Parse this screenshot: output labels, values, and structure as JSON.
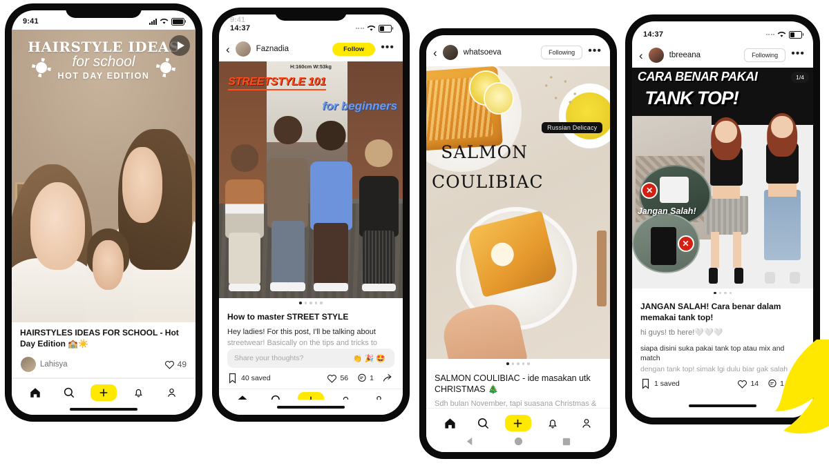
{
  "meta": {
    "background_color": "#ffffff",
    "accent_yellow": "#ffe900"
  },
  "phones": [
    {
      "id": "phone-1",
      "status": {
        "time": "9:41",
        "signal_icon": "cellular-bars-icon",
        "wifi_icon": "wifi-icon",
        "battery_icon": "battery-full-icon"
      },
      "post": {
        "overlay_title_line1": "HAIRSTYLE IDEAS",
        "overlay_title_line2": "for school",
        "overlay_title_line3": "HOT DAY EDITION",
        "play_icon": "play-icon",
        "caption_title": "HAIRSTYLES IDEAS FOR SCHOOL - Hot Day Edition 🏫☀️",
        "author": "Lahisya",
        "like_icon": "heart-icon",
        "like_count": "49"
      },
      "tabbar": {
        "home": "home-icon",
        "search": "search-icon",
        "create": "plus-icon",
        "alerts": "bell-icon",
        "profile": "person-icon"
      }
    },
    {
      "id": "phone-2",
      "status": {
        "time": "14:37",
        "ghost_time": "9:41",
        "signal_icon": "signal-dots-icon",
        "wifi_icon": "wifi-icon",
        "battery_icon": "battery-half-icon"
      },
      "header": {
        "back_icon": "chevron-left-icon",
        "username": "Faznadia",
        "action_label": "Follow",
        "more_icon": "more-dots-icon"
      },
      "post": {
        "measurement": "H:160cm W:53kg",
        "overlay_title_line1": "STREETSTYLE 101",
        "overlay_title_line2": "for beginners",
        "pager_dots": 5,
        "pager_active": 0,
        "caption_title": "How to master STREET STYLE",
        "caption_line1": "Hey ladies! For this post, I'll be talking about",
        "caption_line2": "streetwear! Basically on the tips and tricks to create a",
        "comment_placeholder": "Share your thoughts?",
        "comment_emojis": "👏🎉🤩",
        "save_icon": "bookmark-icon",
        "saved_label": "40 saved",
        "like_icon": "heart-icon",
        "like_count": "56",
        "comment_icon": "comment-icon",
        "comment_count": "1",
        "share_icon": "share-icon"
      }
    },
    {
      "id": "phone-3",
      "header": {
        "back_icon": "chevron-left-icon",
        "username": "whatsoeva",
        "action_label": "Following",
        "more_icon": "more-dots-icon"
      },
      "post": {
        "badge": "Russian Delicacy",
        "overlay_title_line1": "SALMON",
        "overlay_title_line2": "COULIBIAC",
        "pager_dots": 5,
        "pager_active": 0,
        "caption_title": "SALMON COULIBIAC - ide masakan utk CHRISTMAS 🎄",
        "caption_line1": "Sdh bulan November, tapi suasana Christmas & akhir"
      },
      "tabbar": {
        "home": "home-icon",
        "search": "search-icon",
        "create": "plus-icon",
        "alerts": "bell-icon",
        "profile": "person-icon"
      },
      "androidnav": {
        "back": "android-back-icon",
        "home": "android-home-icon",
        "recents": "android-recents-icon"
      }
    },
    {
      "id": "phone-4",
      "status": {
        "time": "14:37",
        "signal_icon": "signal-dots-icon",
        "wifi_icon": "wifi-icon",
        "battery_icon": "battery-half-icon"
      },
      "header": {
        "back_icon": "chevron-left-icon",
        "username": "tbreeana",
        "action_label": "Following",
        "more_icon": "more-dots-icon"
      },
      "post": {
        "overlay_title_line1": "CARA BENAR PAKAI",
        "overlay_title_line2": "TANK TOP!",
        "page_counter": "1/4",
        "sticker_label": "Jangan Salah!",
        "x_mark": "✕",
        "pager_dots": 4,
        "pager_active": 0,
        "caption_title": "JANGAN SALAH! Cara benar dalam memakai tank top!",
        "caption_line1": "hi guys! tb here!🤍🤍🤍",
        "caption_line2": "siapa disini suka pakai tank top atau mix and match",
        "caption_line3": "dengan tank top! simak lgi dulu biar gak salah pasang",
        "save_icon": "bookmark-icon",
        "saved_label": "1 saved",
        "like_icon": "heart-icon",
        "like_count": "14",
        "comment_icon": "comment-icon",
        "comment_count": "1",
        "share_icon": "share-icon"
      }
    }
  ],
  "cursor": {
    "name": "yellow-curved-arrow",
    "color": "#ffe800"
  }
}
